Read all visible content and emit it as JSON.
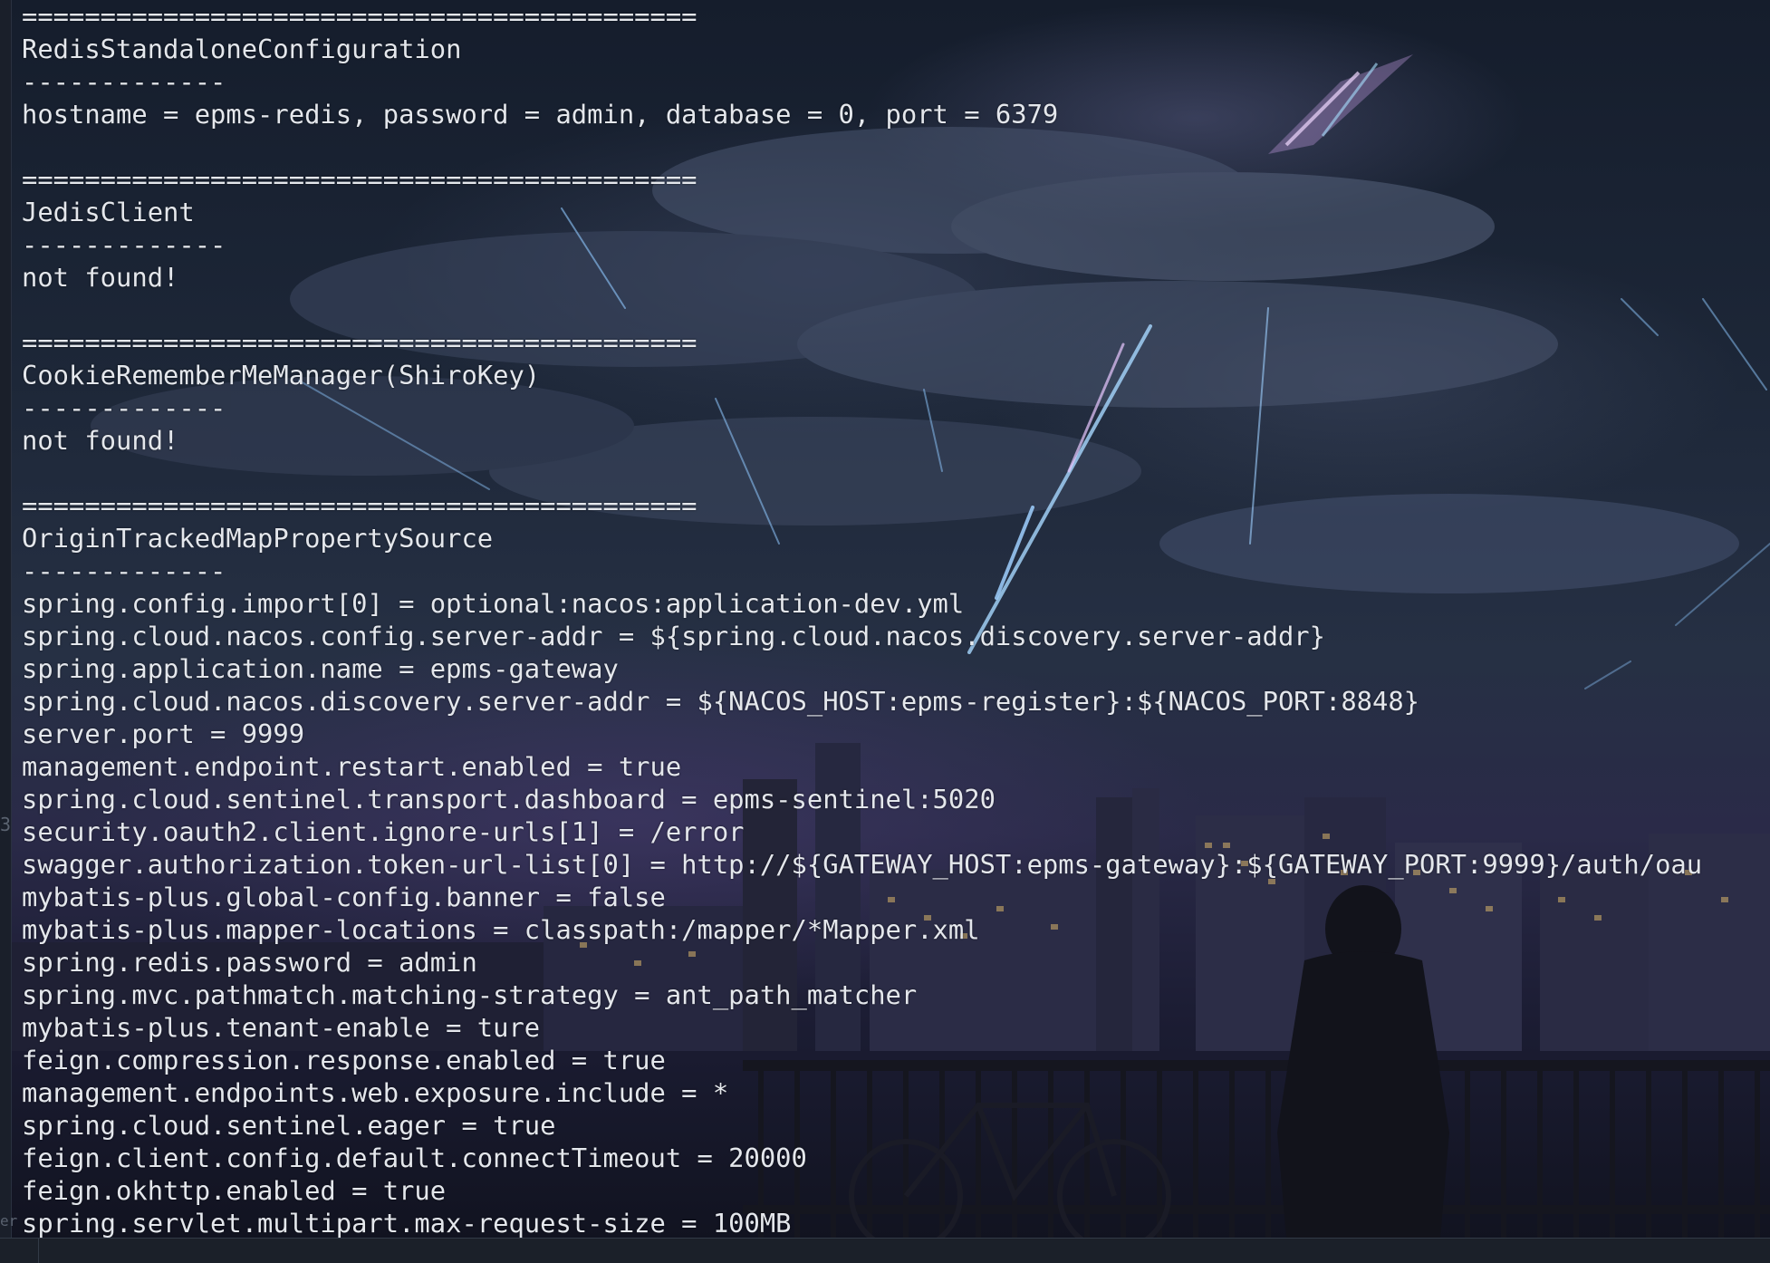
{
  "terminal": {
    "lines": [
      "===========================================",
      "RedisStandaloneConfiguration",
      "-------------",
      "hostname = epms-redis, password = admin, database = 0, port = 6379",
      "",
      "===========================================",
      "JedisClient",
      "-------------",
      "not found!",
      "",
      "===========================================",
      "CookieRememberMeManager(ShiroKey)",
      "-------------",
      "not found!",
      "",
      "===========================================",
      "OriginTrackedMapPropertySource",
      "-------------",
      "spring.config.import[0] = optional:nacos:application-dev.yml",
      "spring.cloud.nacos.config.server-addr = ${spring.cloud.nacos.discovery.server-addr}",
      "spring.application.name = epms-gateway",
      "spring.cloud.nacos.discovery.server-addr = ${NACOS_HOST:epms-register}:${NACOS_PORT:8848}",
      "server.port = 9999",
      "management.endpoint.restart.enabled = true",
      "spring.cloud.sentinel.transport.dashboard = epms-sentinel:5020",
      "security.oauth2.client.ignore-urls[1] = /error",
      "swagger.authorization.token-url-list[0] = http://${GATEWAY_HOST:epms-gateway}:${GATEWAY_PORT:9999}/auth/oau",
      "mybatis-plus.global-config.banner = false",
      "mybatis-plus.mapper-locations = classpath:/mapper/*Mapper.xml",
      "spring.redis.password = admin",
      "spring.mvc.pathmatch.matching-strategy = ant_path_matcher",
      "mybatis-plus.tenant-enable = ture",
      "feign.compression.response.enabled = true",
      "management.endpoints.web.exposure.include = *",
      "spring.cloud.sentinel.eager = true",
      "feign.client.config.default.connectTimeout = 20000",
      "feign.okhttp.enabled = true",
      "spring.servlet.multipart.max-request-size = 100MB"
    ]
  },
  "gutter": {
    "mark_mid": "3",
    "mark_bottom": "er"
  },
  "colors": {
    "text": "#e4e7ec",
    "background": "#1d2738",
    "gutter": "#1a1f2a"
  }
}
